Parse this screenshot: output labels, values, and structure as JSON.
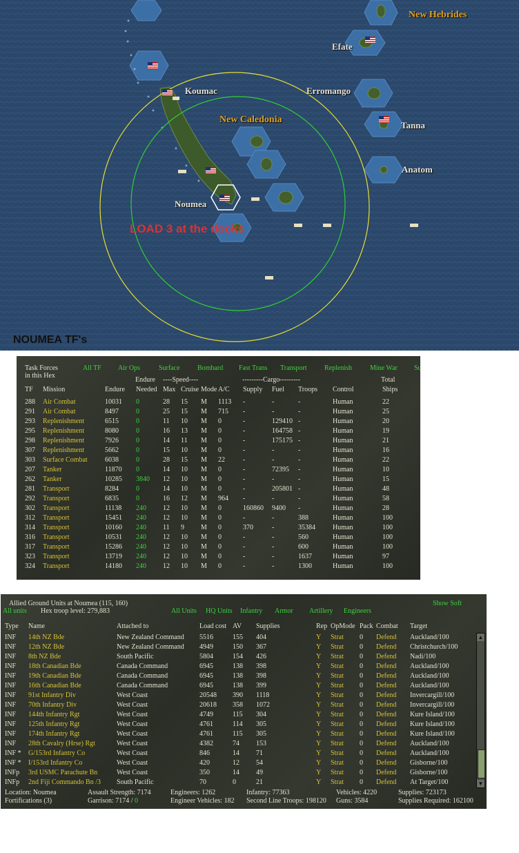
{
  "map": {
    "labels": {
      "new_hebrides": "New Hebrides",
      "efate": "Efate",
      "koumac": "Koumac",
      "erromango": "Erromango",
      "new_caledonia": "New Caledonia",
      "tanna": "Tanna",
      "anatom": "Anatom",
      "noumea": "Noumea"
    },
    "annotation": "LOAD 3 at the docks",
    "colors": {
      "sea": "#2d4a6e",
      "hex_shallow": "#3f72a8",
      "range_outer": "#e8e030",
      "range_inner": "#30d030",
      "annotation": "#e03030"
    }
  },
  "caption": "NOUMEA TF's",
  "tf_panel": {
    "header": {
      "title1": "Task Forces",
      "title2": "in this Hex",
      "filters": [
        "All TF",
        "Air Ops",
        "Surface",
        "Bombard",
        "Fast Trans",
        "Transport",
        "Replenish",
        "Mine War",
        "Su"
      ],
      "endure_group": "Endure",
      "speed_group": "----Speed----",
      "cargo_group": "---------Cargo---------",
      "total_group": "Total",
      "cols": [
        "TF",
        "Mission",
        "Endure",
        "Needed",
        "Max",
        "Cruise",
        "Mode",
        "A/C",
        "Supply",
        "Fuel",
        "Troops",
        "Control",
        "Ships"
      ]
    },
    "rows": [
      [
        "288",
        "Air Combat",
        "10031",
        "0",
        "28",
        "15",
        "M",
        "1113",
        "-",
        "-",
        "-",
        "Human",
        "22"
      ],
      [
        "291",
        "Air Combat",
        "8497",
        "0",
        "25",
        "15",
        "M",
        "715",
        "-",
        "-",
        "-",
        "Human",
        "25"
      ],
      [
        "293",
        "Replenishment",
        "6515",
        "0",
        "11",
        "10",
        "M",
        "0",
        "-",
        "129410",
        "-",
        "Human",
        "20"
      ],
      [
        "295",
        "Replenishment",
        "8080",
        "0",
        "16",
        "13",
        "M",
        "0",
        "-",
        "164758",
        "-",
        "Human",
        "19"
      ],
      [
        "298",
        "Replenishment",
        "7926",
        "0",
        "14",
        "11",
        "M",
        "0",
        "-",
        "175175",
        "-",
        "Human",
        "21"
      ],
      [
        "307",
        "Replenishment",
        "5662",
        "0",
        "15",
        "10",
        "M",
        "0",
        "-",
        "-",
        "-",
        "Human",
        "16"
      ],
      [
        "303",
        "Surface Combat",
        "6038",
        "0",
        "28",
        "15",
        "M",
        "22",
        "-",
        "-",
        "-",
        "Human",
        "22"
      ],
      [
        "207",
        "Tanker",
        "11870",
        "0",
        "14",
        "10",
        "M",
        "0",
        "-",
        "72395",
        "-",
        "Human",
        "10"
      ],
      [
        "262",
        "Tanker",
        "10285",
        "3840",
        "12",
        "10",
        "M",
        "0",
        "-",
        "-",
        "-",
        "Human",
        "15"
      ],
      [
        "281",
        "Transport",
        "8284",
        "0",
        "14",
        "10",
        "M",
        "0",
        "-",
        "205801",
        "-",
        "Human",
        "48"
      ],
      [
        "292",
        "Transport",
        "6835",
        "0",
        "16",
        "12",
        "M",
        "964",
        "-",
        "-",
        "-",
        "Human",
        "58"
      ],
      [
        "302",
        "Transport",
        "11138",
        "240",
        "12",
        "10",
        "M",
        "0",
        "160860",
        "9400",
        "-",
        "Human",
        "28"
      ],
      [
        "312",
        "Transport",
        "15451",
        "240",
        "12",
        "10",
        "M",
        "0",
        "-",
        "-",
        "388",
        "Human",
        "100"
      ],
      [
        "314",
        "Transport",
        "10160",
        "240",
        "11",
        "9",
        "M",
        "0",
        "370",
        "-",
        "35384",
        "Human",
        "100"
      ],
      [
        "316",
        "Transport",
        "10531",
        "240",
        "12",
        "10",
        "M",
        "0",
        "-",
        "-",
        "560",
        "Human",
        "100"
      ],
      [
        "317",
        "Transport",
        "15286",
        "240",
        "12",
        "10",
        "M",
        "0",
        "-",
        "-",
        "600",
        "Human",
        "100"
      ],
      [
        "323",
        "Transport",
        "13719",
        "240",
        "12",
        "10",
        "M",
        "0",
        "-",
        "-",
        "1637",
        "Human",
        "97"
      ],
      [
        "324",
        "Transport",
        "14180",
        "240",
        "12",
        "10",
        "M",
        "0",
        "-",
        "-",
        "1300",
        "Human",
        "100"
      ]
    ]
  },
  "gu_panel": {
    "title": "Allied Ground Units at Noumea  (115, 160)",
    "show_soft": "Show Soft",
    "all_units": "All units",
    "hex_troop": "Hex troop level: 279,883",
    "filters": [
      "All Units",
      "HQ Units",
      "Infantry",
      "Armor",
      "Artillery",
      "Engineers"
    ],
    "cols": [
      "Type",
      "Name",
      "Attached to",
      "Load cost",
      "AV",
      "Supplies",
      "Rep",
      "OpMode",
      "Pack",
      "Combat",
      "Target"
    ],
    "rows": [
      [
        "INF",
        "14th NZ Bde",
        "New Zealand Command",
        "5516",
        "155",
        "404",
        "Y",
        "Strat",
        "0",
        "Defend",
        "Auckland/100"
      ],
      [
        "INF",
        "12th NZ Bde",
        "New Zealand Command",
        "4949",
        "150",
        "367",
        "Y",
        "Strat",
        "0",
        "Defend",
        "Christchurch/100"
      ],
      [
        "INF",
        "8th NZ Bde",
        "South Pacific",
        "5804",
        "154",
        "426",
        "Y",
        "Strat",
        "0",
        "Defend",
        "Nadi/100"
      ],
      [
        "INF",
        "18th Canadian Bde",
        "Canada Command",
        "6945",
        "138",
        "398",
        "Y",
        "Strat",
        "0",
        "Defend",
        "Auckland/100"
      ],
      [
        "INF",
        "19th Canadian Bde",
        "Canada Command",
        "6945",
        "138",
        "398",
        "Y",
        "Strat",
        "0",
        "Defend",
        "Auckland/100"
      ],
      [
        "INF",
        "16th Canadian Bde",
        "Canada Command",
        "6945",
        "138",
        "399",
        "Y",
        "Strat",
        "0",
        "Defend",
        "Auckland/100"
      ],
      [
        "INF",
        "91st Infantry Div",
        "West Coast",
        "20548",
        "390",
        "1118",
        "Y",
        "Strat",
        "0",
        "Defend",
        "Invercargill/100"
      ],
      [
        "INF",
        "70th Infantry Div",
        "West Coast",
        "20618",
        "358",
        "1072",
        "Y",
        "Strat",
        "0",
        "Defend",
        "Invercargill/100"
      ],
      [
        "INF",
        "144th Infantry Rgt",
        "West Coast",
        "4749",
        "115",
        "304",
        "Y",
        "Strat",
        "0",
        "Defend",
        "Kure Island/100"
      ],
      [
        "INF",
        "125th Infantry Rgt",
        "West Coast",
        "4761",
        "114",
        "305",
        "Y",
        "Strat",
        "0",
        "Defend",
        "Kure Island/100"
      ],
      [
        "INF",
        "174th Infantry Rgt",
        "West Coast",
        "4761",
        "115",
        "305",
        "Y",
        "Strat",
        "0",
        "Defend",
        "Kure Island/100"
      ],
      [
        "INF",
        "28th Cavalry (Hrse) Rgt",
        "West Coast",
        "4382",
        "74",
        "153",
        "Y",
        "Strat",
        "0",
        "Defend",
        "Auckland/100"
      ],
      [
        "INF *",
        "G/153rd Infantry Co",
        "West Coast",
        "846",
        "14",
        "71",
        "Y",
        "Strat",
        "0",
        "Defend",
        "Auckland/100"
      ],
      [
        "INF *",
        "I/153rd Infantry Co",
        "West Coast",
        "420",
        "12",
        "54",
        "Y",
        "Strat",
        "0",
        "Defend",
        "Gisborne/100"
      ],
      [
        "INFp",
        "3rd USMC Parachute Bn",
        "West Coast",
        "350",
        "14",
        "49",
        "Y",
        "Strat",
        "0",
        "Defend",
        "Gisborne/100"
      ],
      [
        "INFp",
        "2nd Fiji Commando Bn /3",
        "South Pacific",
        "70",
        "0",
        "21",
        "Y",
        "Strat",
        "0",
        "Defend",
        "At Target/100"
      ]
    ],
    "footer": {
      "location": "Location: Noumea",
      "fortifications": "Fortifications (3)",
      "assault": "Assault Strength: 7174",
      "garrison": "Garrison: 7174 /",
      "garrison_req": "0",
      "engineers": "Engineers: 1262",
      "eng_vehicles": "Engineer Vehicles: 182",
      "infantry": "Infantry: 77363",
      "second_line": "Second Line Troops: 198120",
      "vehicles": "Vehicles: 4220",
      "guns": "Guns: 3584",
      "supplies": "Supplies: 723173",
      "supplies_req": "Supplies Required: 162100"
    }
  }
}
